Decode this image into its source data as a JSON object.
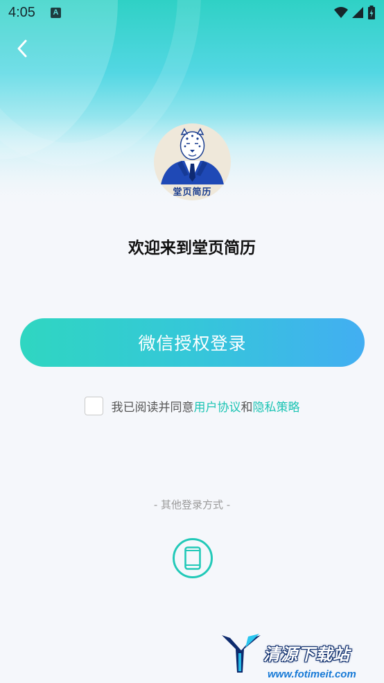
{
  "status_bar": {
    "time": "4:05",
    "notification_badge": "A"
  },
  "header": {
    "back_icon": "chevron-left-icon"
  },
  "logo": {
    "text": "堂页简历"
  },
  "welcome": {
    "title": "欢迎来到堂页简历"
  },
  "login": {
    "wechat_button": "微信授权登录"
  },
  "agreement": {
    "prefix": "我已阅读并同意",
    "user_agreement": "用户协议",
    "and": "和",
    "privacy_policy": "隐私策略",
    "checked": false
  },
  "other_login": {
    "label": "- 其他登录方式 -",
    "phone_icon": "phone-icon"
  },
  "watermark": {
    "title": "清源下载站",
    "url": "www.fotimeit.com"
  },
  "colors": {
    "accent": "#1cc4b4",
    "button_start": "#2fd6c1",
    "button_end": "#42aef2"
  }
}
